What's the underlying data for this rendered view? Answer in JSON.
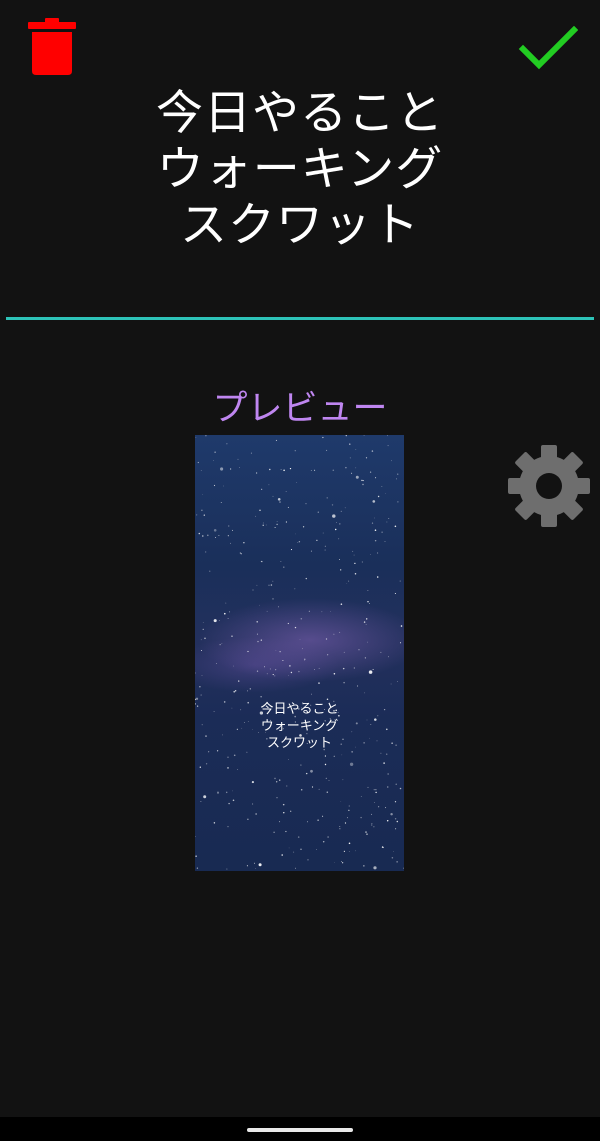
{
  "title_lines": [
    "今日やること",
    "ウォーキング",
    "スクワット"
  ],
  "preview": {
    "label": "プレビュー",
    "card_lines": [
      "今日やること",
      "ウォーキング",
      "スクワット"
    ]
  },
  "icons": {
    "delete": "trash-icon",
    "confirm": "checkmark-icon",
    "settings": "gear-icon"
  },
  "colors": {
    "background": "#121212",
    "delete": "#ff0000",
    "confirm": "#22cc22",
    "settings": "#6e6e6e",
    "divider": "#2dc3b8",
    "preview_label": "#bf86f0"
  }
}
